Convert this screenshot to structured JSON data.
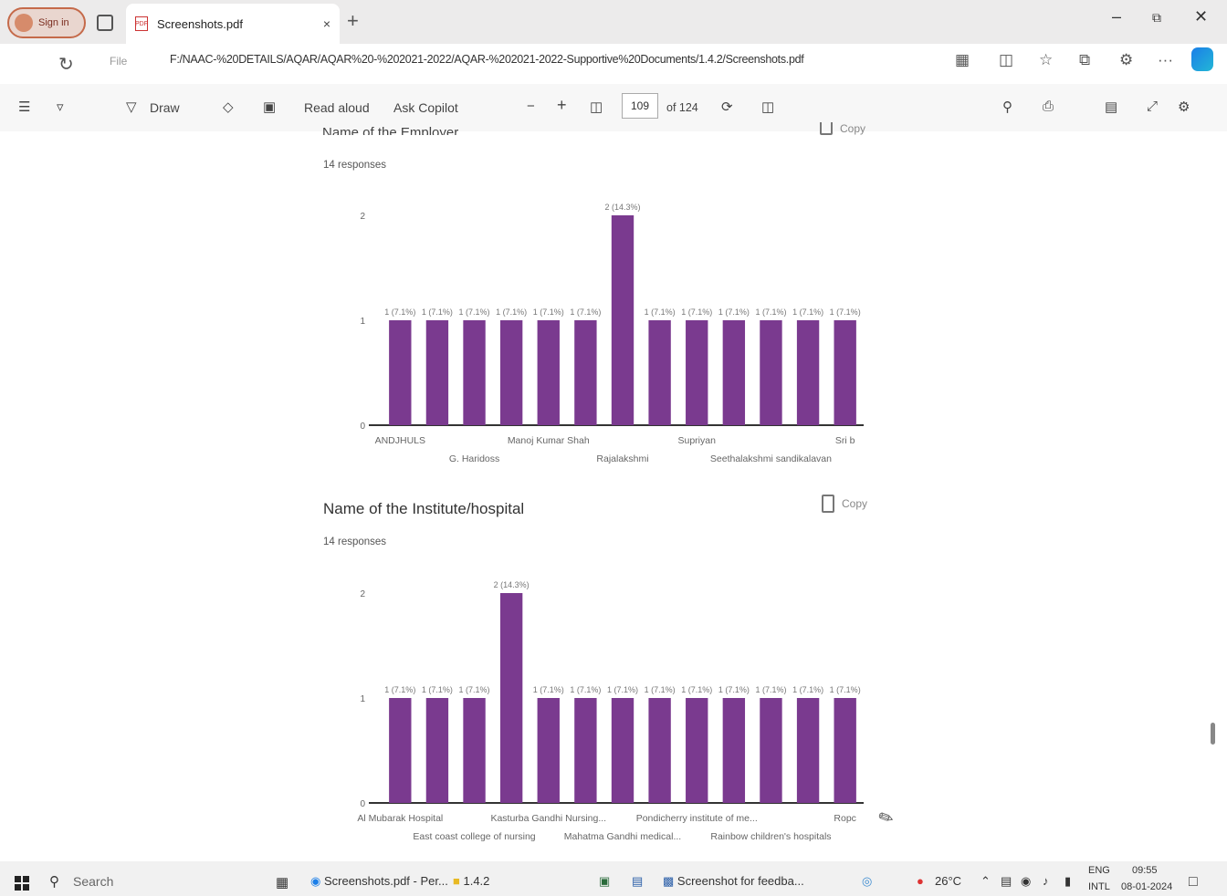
{
  "browser": {
    "sign_in": "Sign in",
    "tab_title": "Screenshots.pdf",
    "tab_close": "×",
    "new_tab": "+",
    "file_label": "File",
    "url": "F:/NAAC-%20DETAILS/AQAR/AQAR%20-%202021-2022/AQAR-%202021-2022-Supportive%20Documents/1.4.2/Screenshots.pdf",
    "more": "···"
  },
  "pdf_toolbar": {
    "draw": "Draw",
    "read_aloud": "Read aloud",
    "ask_copilot": "Ask Copilot",
    "zoom_out": "−",
    "zoom_in": "+",
    "page_current": "109",
    "page_total": "of 124"
  },
  "content": {
    "cut_heading": "Name of the Employer",
    "cut_copy": "Copy",
    "q1_responses": "14 responses",
    "q2_title": "Name of the Institute/hospital",
    "q2_copy": "Copy",
    "q2_responses": "14 responses"
  },
  "chart_data": [
    {
      "type": "bar",
      "title": "Name of the Employer",
      "ylim": [
        0,
        2
      ],
      "yticks": [
        "0",
        "1",
        "2"
      ],
      "values": [
        1,
        1,
        1,
        1,
        1,
        1,
        2,
        1,
        1,
        1,
        1,
        1,
        1
      ],
      "bar_labels": [
        "1 (7.1%)",
        "1 (7.1%)",
        "1 (7.1%)",
        "1 (7.1%)",
        "1 (7.1%)",
        "1 (7.1%)",
        "2 (14.3%)",
        "1 (7.1%)",
        "1 (7.1%)",
        "1 (7.1%)",
        "1 (7.1%)",
        "1 (7.1%)",
        "1 (7.1%)"
      ],
      "category_labels_row1": [
        {
          "text": "ANDJHULS",
          "bar": 0
        },
        {
          "text": "Manoj Kumar Shah",
          "bar": 4
        },
        {
          "text": "Supriyan",
          "bar": 8
        },
        {
          "text": "Sri b",
          "bar": 12
        }
      ],
      "category_labels_row2": [
        {
          "text": "G. Haridoss",
          "bar": 2
        },
        {
          "text": "Rajalakshmi",
          "bar": 6
        },
        {
          "text": "Seethalakshmi sandikalavan",
          "bar": 10
        }
      ],
      "color": "#7a3a8f"
    },
    {
      "type": "bar",
      "title": "Name of the Institute/hospital",
      "ylim": [
        0,
        2
      ],
      "yticks": [
        "0",
        "1",
        "2"
      ],
      "values": [
        1,
        1,
        1,
        2,
        1,
        1,
        1,
        1,
        1,
        1,
        1,
        1,
        1
      ],
      "bar_labels": [
        "1 (7.1%)",
        "1 (7.1%)",
        "1 (7.1%)",
        "2 (14.3%)",
        "1 (7.1%)",
        "1 (7.1%)",
        "1 (7.1%)",
        "1 (7.1%)",
        "1 (7.1%)",
        "1 (7.1%)",
        "1 (7.1%)",
        "1 (7.1%)",
        "1 (7.1%)"
      ],
      "category_labels_row1": [
        {
          "text": "Al Mubarak Hospital",
          "bar": 0
        },
        {
          "text": "Kasturba Gandhi Nursing...",
          "bar": 4
        },
        {
          "text": "Pondicherry institute of me...",
          "bar": 8
        },
        {
          "text": "Ropc",
          "bar": 12
        }
      ],
      "category_labels_row2": [
        {
          "text": "East coast college of nursing",
          "bar": 2
        },
        {
          "text": "Mahatma Gandhi medical...",
          "bar": 6
        },
        {
          "text": "Rainbow children's hospitals",
          "bar": 10
        }
      ],
      "color": "#7a3a8f"
    }
  ],
  "taskbar": {
    "search": "Search",
    "app1": "Screenshots.pdf - Per...",
    "app2": "1.4.2",
    "app3": "Screenshot for feedba...",
    "temperature": "26°C",
    "lang1": "ENG",
    "lang2": "INTL",
    "time": "09:55",
    "date": "08-01-2024"
  }
}
